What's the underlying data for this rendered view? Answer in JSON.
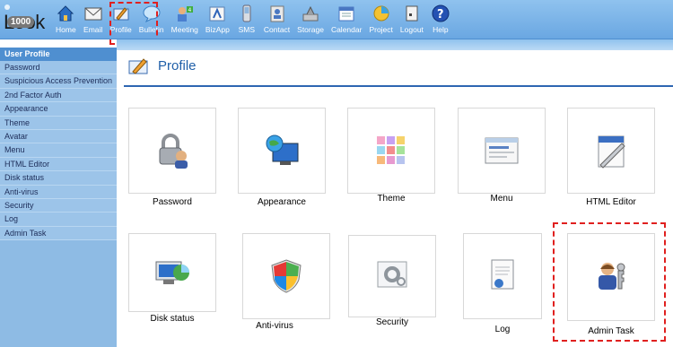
{
  "app": {
    "logo_text": "Look",
    "badge_count": "1000"
  },
  "toolbar": {
    "items": [
      {
        "label": "Home",
        "icon": "home-icon"
      },
      {
        "label": "Email",
        "icon": "email-icon"
      },
      {
        "label": "Profile",
        "icon": "profile-icon"
      },
      {
        "label": "Bulletin",
        "icon": "bulletin-icon"
      },
      {
        "label": "Meeting",
        "icon": "meeting-icon"
      },
      {
        "label": "BizApp",
        "icon": "bizapp-icon"
      },
      {
        "label": "SMS",
        "icon": "sms-icon"
      },
      {
        "label": "Contact",
        "icon": "contact-icon"
      },
      {
        "label": "Storage",
        "icon": "storage-icon"
      },
      {
        "label": "Calendar",
        "icon": "calendar-icon"
      },
      {
        "label": "Project",
        "icon": "project-icon"
      },
      {
        "label": "Logout",
        "icon": "logout-icon"
      },
      {
        "label": "Help",
        "icon": "help-icon"
      }
    ]
  },
  "sidebar": {
    "header": "User Profile",
    "items": [
      {
        "label": "Password"
      },
      {
        "label": "Suspicious Access Prevention"
      },
      {
        "label": "2nd Factor Auth"
      },
      {
        "label": "Appearance"
      },
      {
        "label": "Theme"
      },
      {
        "label": "Avatar"
      },
      {
        "label": "Menu"
      },
      {
        "label": "HTML Editor"
      },
      {
        "label": "Disk status"
      },
      {
        "label": "Anti-virus"
      },
      {
        "label": "Security"
      },
      {
        "label": "Log"
      },
      {
        "label": "Admin Task"
      }
    ]
  },
  "main": {
    "title": "Profile",
    "tiles": [
      {
        "label": "Password",
        "icon": "lock-user-icon"
      },
      {
        "label": "Appearance",
        "icon": "monitor-globe-icon"
      },
      {
        "label": "Theme",
        "icon": "color-palette-icon"
      },
      {
        "label": "Menu",
        "icon": "menu-window-icon"
      },
      {
        "label": "HTML Editor",
        "icon": "html-editor-icon"
      },
      {
        "label": "Disk status",
        "icon": "disk-chart-icon"
      },
      {
        "label": "Anti-virus",
        "icon": "shield-icon"
      },
      {
        "label": "Security",
        "icon": "security-gear-icon"
      },
      {
        "label": "Log",
        "icon": "log-document-icon"
      },
      {
        "label": "Admin Task",
        "icon": "admin-keys-icon"
      }
    ]
  },
  "colors": {
    "toolbar": "#6aa7e2",
    "sidebar": "#9cc4e9",
    "accent": "#2e66b2",
    "highlight": "#e0201f"
  }
}
